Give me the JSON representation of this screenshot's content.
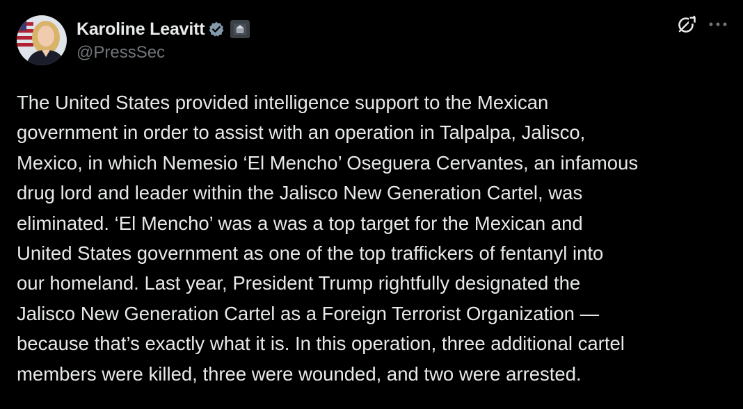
{
  "author": {
    "display_name": "Karoline Leavitt",
    "handle": "@PressSec",
    "verified_icon": "verified-badge-icon",
    "affiliation_icon": "white-house-affiliation-icon"
  },
  "actions": {
    "grok_icon": "grok-icon",
    "more_icon": "more-options-icon"
  },
  "post": {
    "text": "The United States provided intelligence support to the Mexican\ngovernment in order to assist with an operation in Talpalpa, Jalisco,\nMexico, in which Nemesio ‘El Mencho’ Oseguera Cervantes, an infamous\ndrug lord and leader within the Jalisco New Generation Cartel, was\neliminated. ‘El Mencho’ was a was a top target for the Mexican and\nUnited States government as one of the top traffickers of fentanyl into\nour homeland. Last year, President Trump rightfully designated the\nJalisco New Generation Cartel as a Foreign Terrorist Organization —\nbecause that’s exactly what it is. In this operation, three additional cartel\nmembers were killed, three were wounded, and two were arrested."
  },
  "colors": {
    "background": "#000000",
    "text_primary": "#e7e9ea",
    "text_secondary": "#71767b",
    "verified_gray": "#829aab"
  }
}
